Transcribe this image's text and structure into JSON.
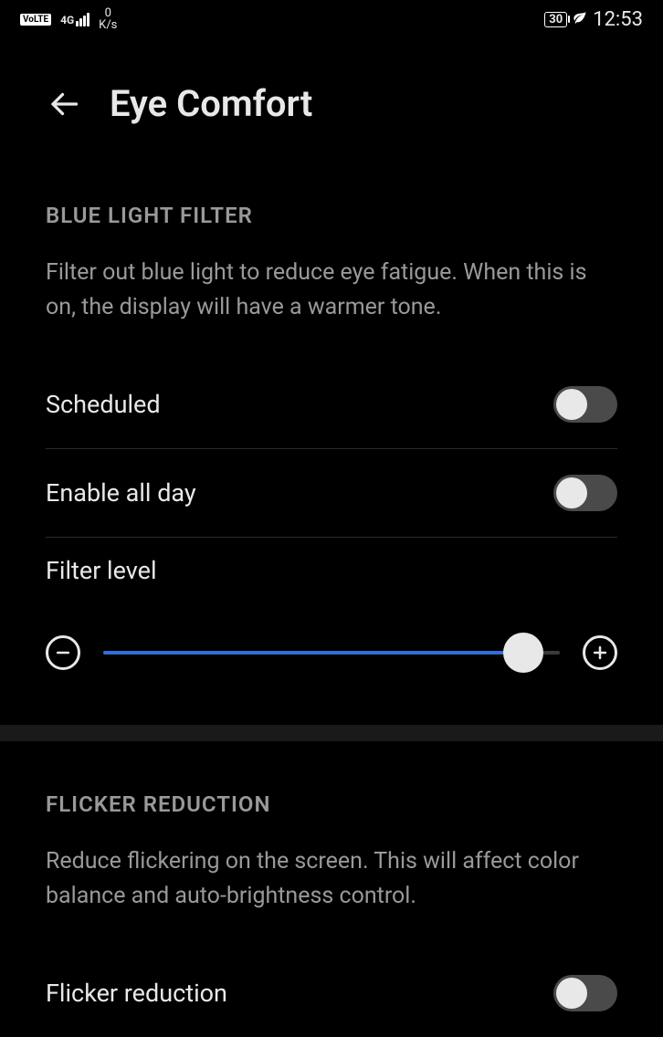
{
  "statusBar": {
    "volte": "VoLTE",
    "network": "4G",
    "speedValue": "0",
    "speedUnit": "K/s",
    "battery": "30",
    "clock": "12:53"
  },
  "header": {
    "title": "Eye Comfort"
  },
  "sections": {
    "blueLight": {
      "header": "BLUE LIGHT FILTER",
      "description": "Filter out blue light to reduce eye fatigue. When this is on, the display will have a warmer tone.",
      "scheduled": {
        "label": "Scheduled",
        "value": false
      },
      "enableAllDay": {
        "label": "Enable all day",
        "value": false
      },
      "filterLevel": {
        "label": "Filter level",
        "value": 92
      }
    },
    "flicker": {
      "header": "FLICKER REDUCTION",
      "description": "Reduce flickering on the screen. This will affect color balance and auto-brightness control.",
      "flickerReduction": {
        "label": "Flicker reduction",
        "value": false
      }
    }
  }
}
